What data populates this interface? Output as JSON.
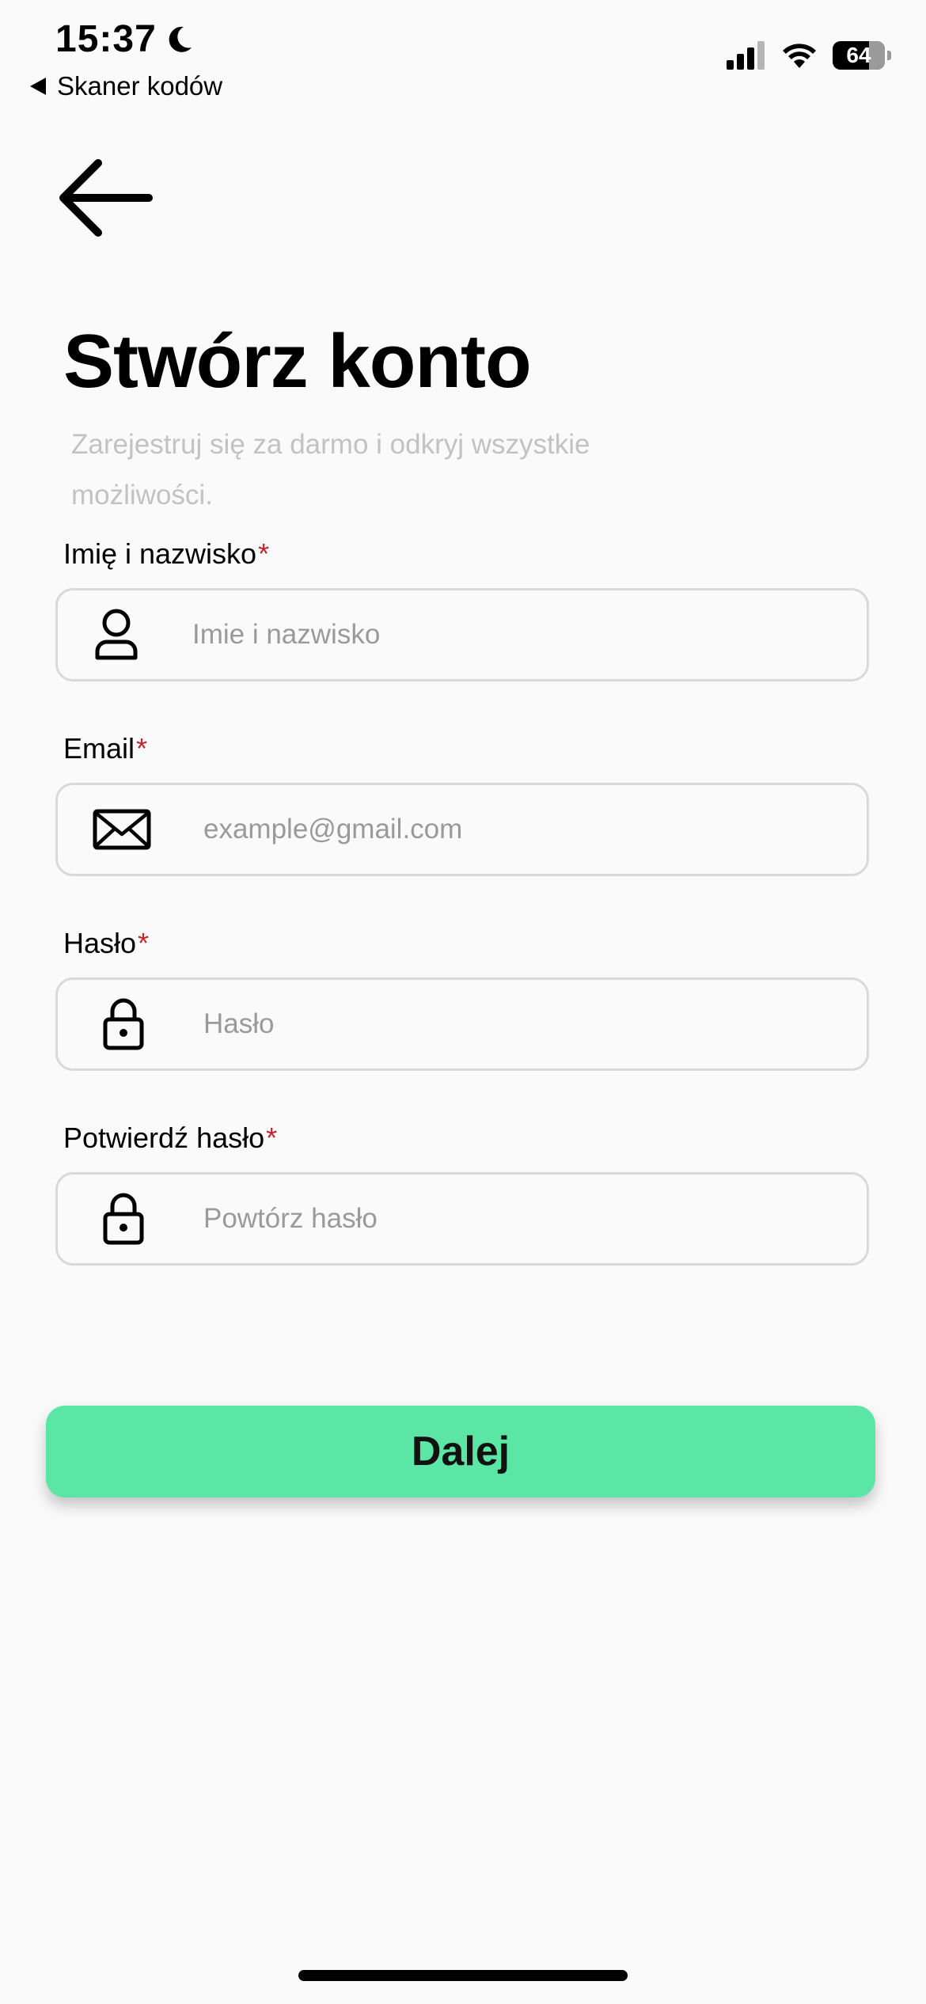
{
  "status_bar": {
    "time": "15:37",
    "back_app_label": "Skaner kodów",
    "battery_level": "64",
    "icons": [
      "moon-icon",
      "cellular-signal-icon",
      "wifi-icon",
      "battery-icon"
    ]
  },
  "header": {
    "title": "Stwórz konto",
    "subtitle": "Zarejestruj się za darmo i odkryj wszystkie możliwości."
  },
  "form": {
    "required_mark": "*",
    "fields": [
      {
        "label": "Imię i nazwisko",
        "placeholder": "Imie i nazwisko",
        "value": "",
        "icon": "person-icon"
      },
      {
        "label": "Email",
        "placeholder": "example@gmail.com",
        "value": "",
        "icon": "envelope-icon"
      },
      {
        "label": "Hasło",
        "placeholder": "Hasło",
        "value": "",
        "icon": "lock-icon"
      },
      {
        "label": "Potwierdź hasło",
        "placeholder": "Powtórz hasło",
        "value": "",
        "icon": "lock-icon"
      }
    ]
  },
  "actions": {
    "next_label": "Dalej"
  },
  "colors": {
    "background": "#fafafa",
    "primary_button": "#5be6a6",
    "required": "#c0272d",
    "subtitle": "#c2c2c2",
    "placeholder": "#9a9a9a",
    "field_border": "#d9d9d9"
  }
}
